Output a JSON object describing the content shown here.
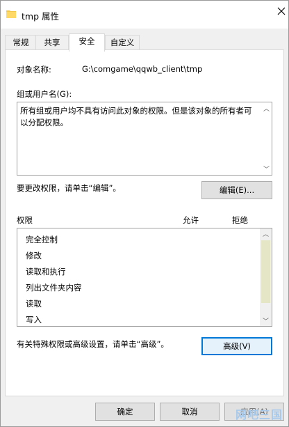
{
  "window": {
    "title": "tmp 属性"
  },
  "tabs": [
    {
      "label": "常规"
    },
    {
      "label": "共享"
    },
    {
      "label": "安全"
    },
    {
      "label": "自定义"
    }
  ],
  "security": {
    "object_name_label": "对象名称:",
    "object_name_value": "G:\\comgame\\qqwb_client\\tmp",
    "group_label": "组或用户名(G):",
    "group_message": "所有组或用户均不具有访问此对象的权限。但是该对象的所有者可以分配权限。",
    "change_hint": "要更改权限，请单击“编辑”。",
    "edit_button": "编辑(E)...",
    "permissions_header": "权限",
    "allow_header": "允许",
    "deny_header": "拒绝",
    "permissions": [
      "完全控制",
      "修改",
      "读取和执行",
      "列出文件夹内容",
      "读取",
      "写入"
    ],
    "advanced_hint": "有关特殊权限或高级设置，请单击“高级”。",
    "advanced_button": "高级(V)"
  },
  "footer": {
    "ok_button": "确定",
    "cancel_button": "取消",
    "apply_button": "应用(A)"
  },
  "watermark": "网吧三国",
  "icons": {
    "folder": "folder-icon",
    "close": "close-icon",
    "up": "scroll-up-arrow-icon",
    "down": "scroll-down-arrow-icon"
  }
}
